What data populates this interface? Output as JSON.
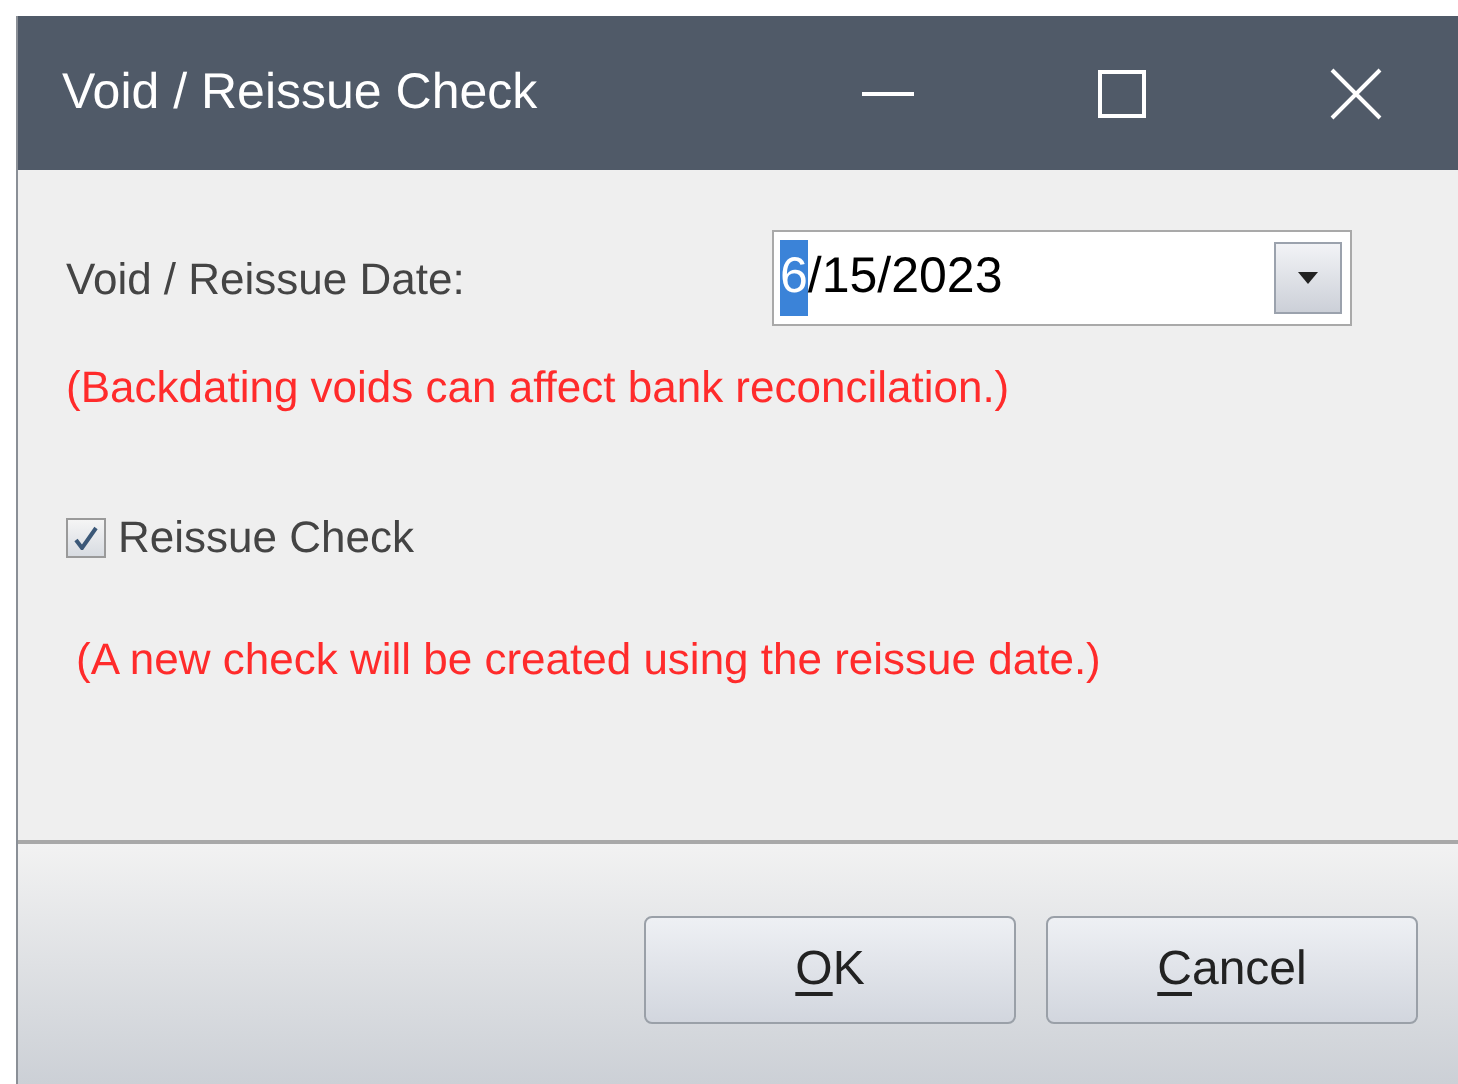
{
  "window": {
    "title": "Void / Reissue Check"
  },
  "date": {
    "label": "Void / Reissue Date:",
    "segments": [
      {
        "text": "6",
        "selected": true
      },
      {
        "text": "/15/2023",
        "selected": false
      }
    ]
  },
  "date_warning": "(Backdating voids can affect bank reconcilation.)",
  "reissue": {
    "label": "Reissue Check",
    "checked": true
  },
  "reissue_note": "(A new check will be created using the reissue date.)",
  "buttons": [
    {
      "label": "OK",
      "underline_first": true
    },
    {
      "label": "Cancel",
      "underline_first": true
    }
  ]
}
